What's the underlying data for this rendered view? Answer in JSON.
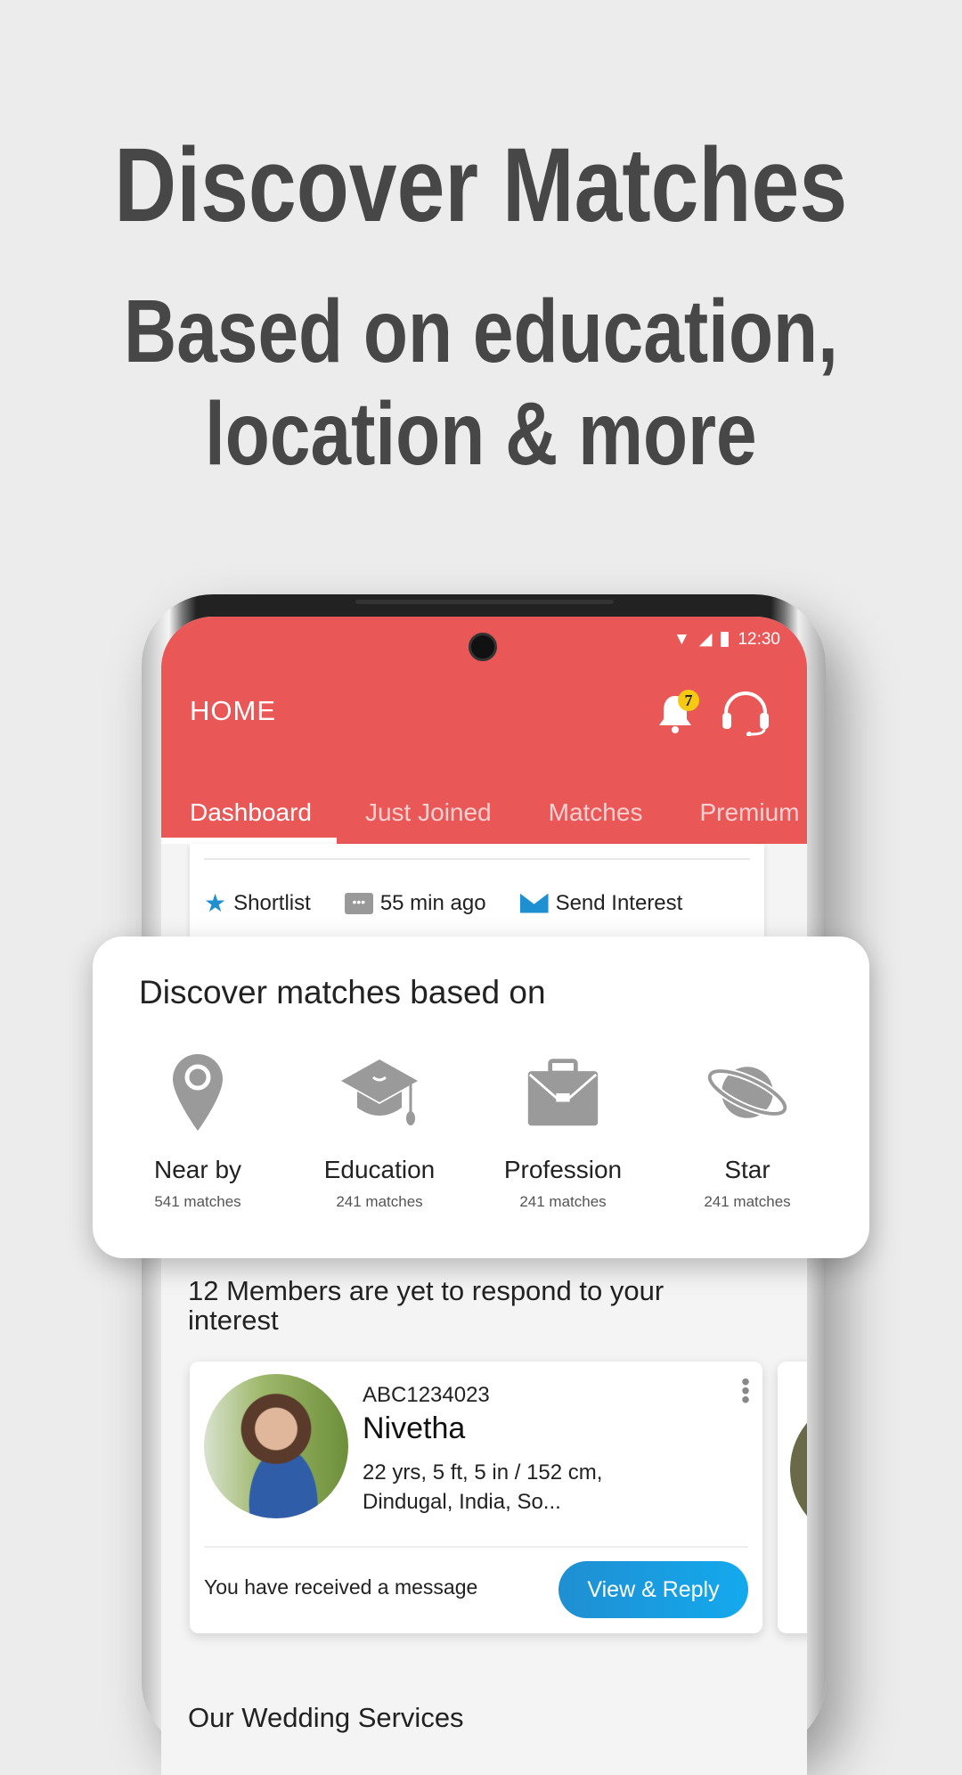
{
  "headline": {
    "line1": "Discover Matches",
    "line2": "Based on education,",
    "line3": "location & more"
  },
  "status_bar": {
    "time": "12:30"
  },
  "app_bar": {
    "title": "HOME",
    "notification_count": "7"
  },
  "tabs": [
    {
      "label": "Dashboard",
      "active": true
    },
    {
      "label": "Just Joined"
    },
    {
      "label": "Matches"
    },
    {
      "label": "Premium"
    }
  ],
  "top_card_actions": {
    "shortlist": "Shortlist",
    "time": "55 min ago",
    "send_interest": "Send Interest"
  },
  "discover": {
    "title": "Discover matches based on",
    "categories": [
      {
        "label": "Near by",
        "count": "541 matches",
        "icon": "location-pin-icon"
      },
      {
        "label": "Education",
        "count": "241 matches",
        "icon": "graduation-cap-icon"
      },
      {
        "label": "Profession",
        "count": "241 matches",
        "icon": "briefcase-icon"
      },
      {
        "label": "Star",
        "count": "241 matches",
        "icon": "planet-icon"
      }
    ]
  },
  "members": {
    "heading": "12 Members are yet to respond to your interest"
  },
  "profile": {
    "id": "ABC1234023",
    "name": "Nivetha",
    "details_line1": "22 yrs, 5 ft, 5 in / 152 cm,",
    "details_line2": "Dindugal, India, So...",
    "message": "You have received a message",
    "button": "View & Reply"
  },
  "services": {
    "heading": "Our Wedding Services"
  },
  "colors": {
    "header": "#ea5757",
    "accent_blue": "#1a9de0",
    "badge": "#f6c913",
    "icon_gray": "#9a9a9a"
  }
}
